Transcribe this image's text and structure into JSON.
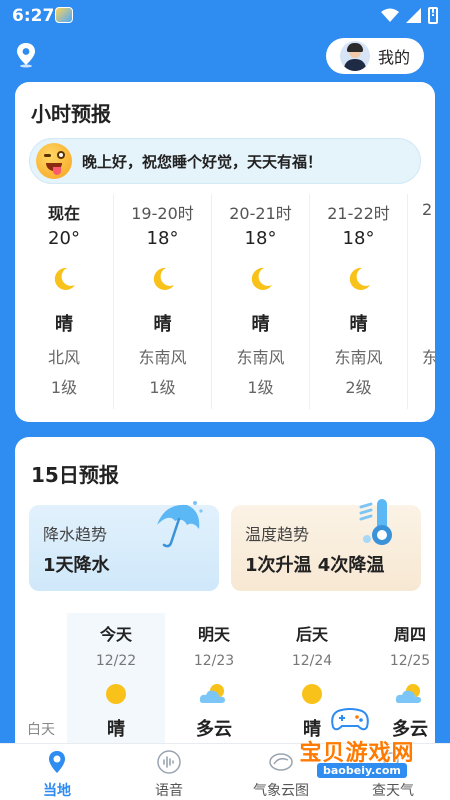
{
  "status_bar": {
    "time": "6:27"
  },
  "header": {
    "profile_label": "我的"
  },
  "hourly": {
    "title": "小时预报",
    "greeting": "晚上好，祝您睡个好觉，天天有福！",
    "hours": [
      {
        "time": "现在",
        "temp": "20°",
        "cond": "晴",
        "wind": "北风",
        "level": "1级"
      },
      {
        "time": "19-20时",
        "temp": "18°",
        "cond": "晴",
        "wind": "东南风",
        "level": "1级"
      },
      {
        "time": "20-21时",
        "temp": "18°",
        "cond": "晴",
        "wind": "东南风",
        "level": "1级"
      },
      {
        "time": "21-22时",
        "temp": "18°",
        "cond": "晴",
        "wind": "东南风",
        "level": "2级"
      },
      {
        "time": "2",
        "temp": "",
        "cond": "",
        "wind": "东",
        "level": ""
      }
    ]
  },
  "daily": {
    "title": "15日预报",
    "rain_trend": {
      "label": "降水趋势",
      "value": "1天降水"
    },
    "temp_trend": {
      "label": "温度趋势",
      "value": "1次升温 4次降温"
    },
    "row_label": "白天",
    "days": [
      {
        "name": "今天",
        "date": "12/22",
        "icon": "sun-icon",
        "cond": "晴"
      },
      {
        "name": "明天",
        "date": "12/23",
        "icon": "partly-cloudy-icon",
        "cond": "多云"
      },
      {
        "name": "后天",
        "date": "12/24",
        "icon": "sun-icon",
        "cond": "晴"
      },
      {
        "name": "周四",
        "date": "12/25",
        "icon": "partly-cloudy-icon",
        "cond": "多云"
      }
    ]
  },
  "bottom_nav": [
    {
      "label": "当地",
      "icon": "location-pin-icon",
      "active": true
    },
    {
      "label": "语音",
      "icon": "voice-wave-icon",
      "active": false
    },
    {
      "label": "气象云图",
      "icon": "radar-cloud-icon",
      "active": false
    },
    {
      "label": "查天气",
      "icon": "search-weather-icon",
      "active": false
    }
  ],
  "watermark": {
    "text": "宝贝游戏网",
    "url": "baobeiy.com"
  },
  "colors": {
    "primary": "#2f8cf0",
    "watermark": "#ff7a00",
    "moon": "#f8c21a"
  }
}
